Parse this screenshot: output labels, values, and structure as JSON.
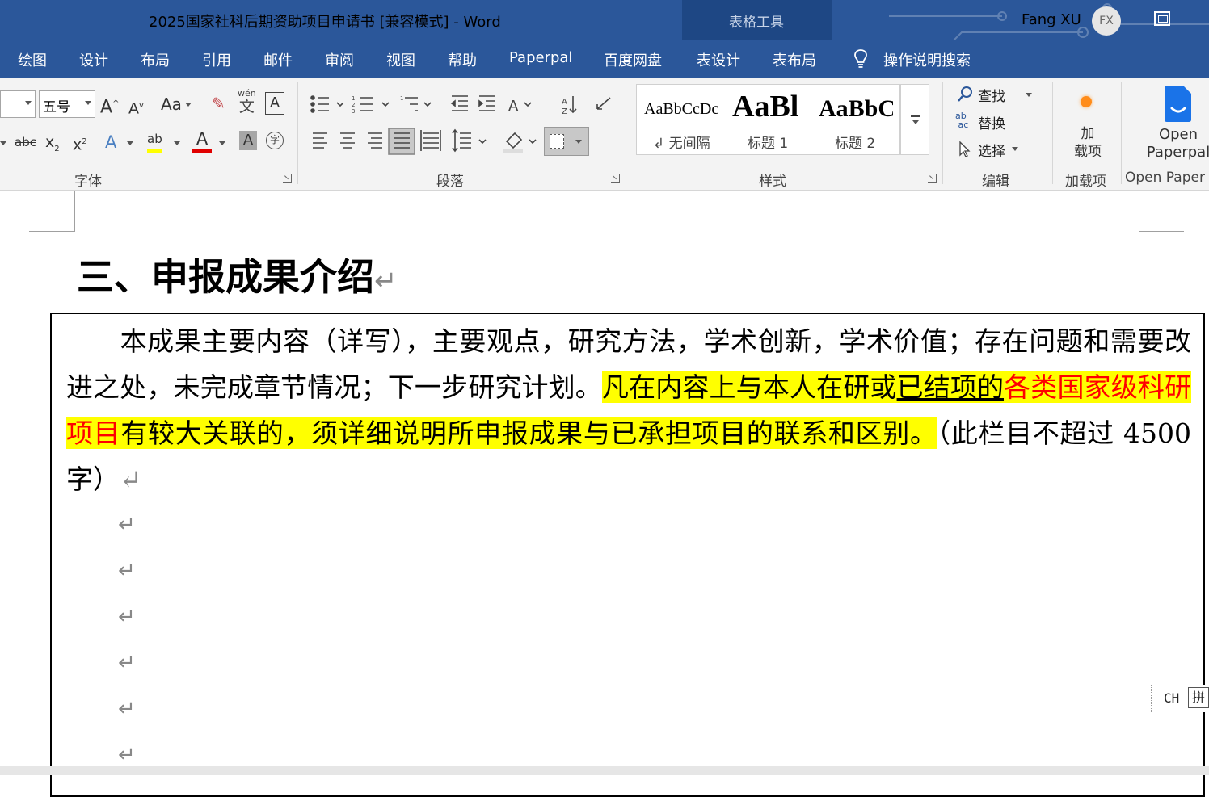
{
  "window": {
    "title": "2025国家社科后期资助项目申请书 [兼容模式]  -  Word",
    "context_tab_group": "表格工具",
    "user_name": "Fang XU",
    "user_initials": "FX"
  },
  "tabs": [
    "绘图",
    "设计",
    "布局",
    "引用",
    "邮件",
    "审阅",
    "视图",
    "帮助",
    "Paperpal",
    "百度网盘",
    "表设计",
    "表布局",
    "操作说明搜索"
  ],
  "ribbon": {
    "font": {
      "size_value": "五号",
      "grow_label": "A",
      "shrink_label": "A",
      "case_label": "Aa",
      "phonetic_label": "wén",
      "phonetic_char": "文",
      "border_char_label": "A",
      "strike_label": "abc",
      "sub_label": "x",
      "sub_suffix": "2",
      "sup_label": "x",
      "sup_suffix": "2",
      "effects_label": "A",
      "highlight_label": "ab",
      "font_color_label": "A",
      "shading_label": "A",
      "enclose_label": "字",
      "group_label": "字体"
    },
    "paragraph": {
      "group_label": "段落"
    },
    "styles": {
      "items": [
        {
          "sample": "AaBbCcDc",
          "name": "↲ 无间隔"
        },
        {
          "sample": "AaBl",
          "name": "标题 1"
        },
        {
          "sample": "AaBbC",
          "name": "标题 2"
        }
      ],
      "group_label": "样式"
    },
    "editing": {
      "find": "查找",
      "replace": "替换",
      "select": "选择",
      "group_label": "编辑"
    },
    "addins": {
      "button": "加\n载项",
      "group_label": "加载项"
    },
    "paperpal": {
      "button_line1": "Open",
      "button_line2": "Paperpal",
      "group_label": "Open Paper"
    }
  },
  "document": {
    "heading": "三、申报成果介绍",
    "paragraph_mark": "↵",
    "para_normal_1": "本成果主要内容（详写），主要观点，研究方法，学术创新，学术价值；存在问题和需要改进之处，未完成章节情况；下一步研究计划。",
    "para_hl_1": "凡在内容上与本人在研或",
    "para_hl_ul": "已结项的",
    "para_hl_red": "各类国家级科研项目",
    "para_hl_2": "有较大关联的，须详细说明所申报成果与已承担项目的联系和区别。",
    "para_normal_2": "（此栏目不超过 4500 字）",
    "empty_paragraphs": 6
  },
  "ime": {
    "mode": "CH",
    "pinyin": "拼"
  },
  "colors": {
    "ribbon_blue": "#2b579a",
    "highlight": "#ffff00",
    "red_text": "#ff0000"
  }
}
